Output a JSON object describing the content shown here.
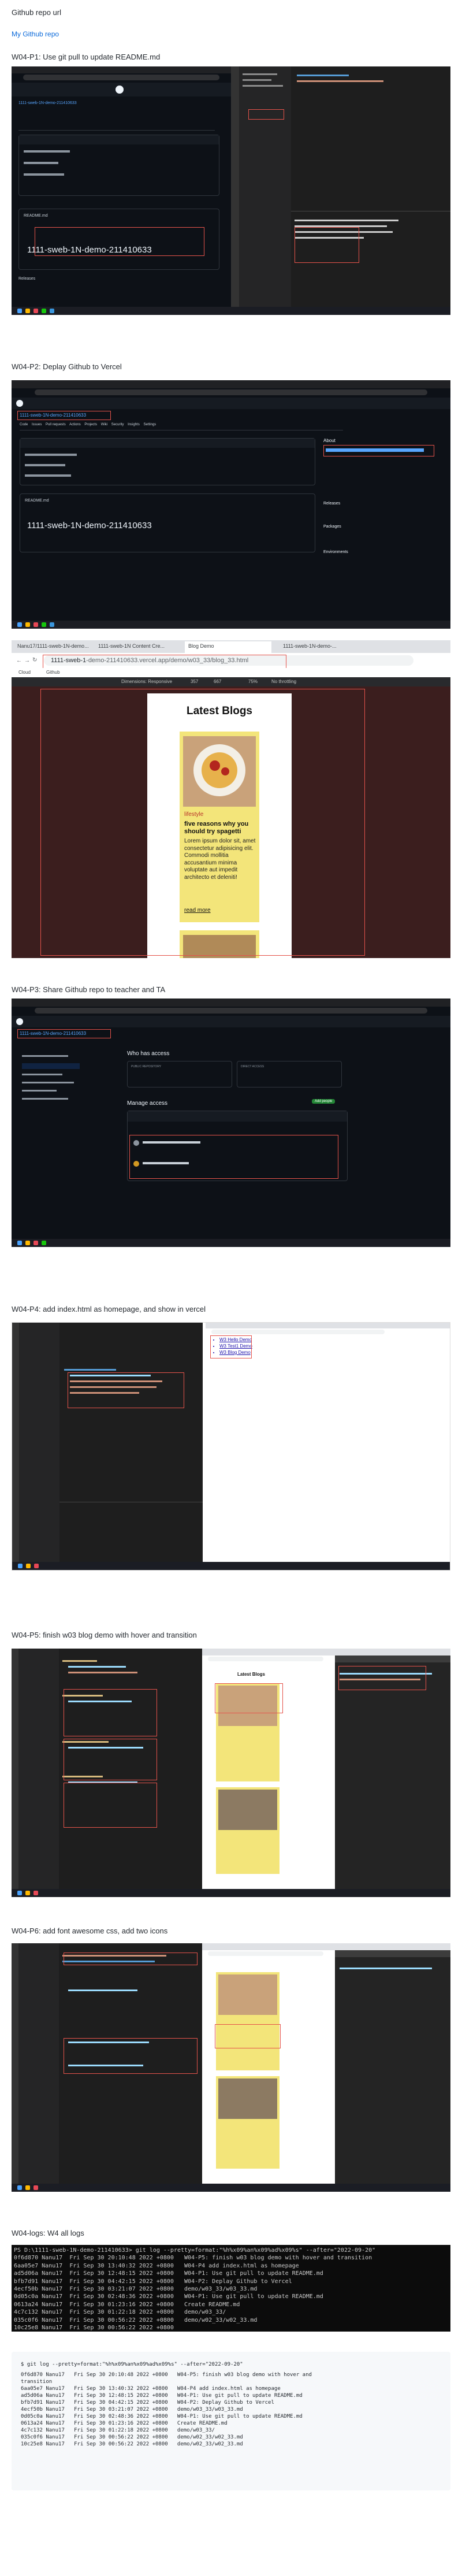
{
  "page": {
    "repo_heading": "Github repo url",
    "repo_link": "My Github repo"
  },
  "sections": {
    "p1": {
      "title": "W04-P1: Use git pull to update README.md"
    },
    "p2": {
      "title": "W04-P2: Deplay Github to Vercel"
    },
    "p3": {
      "title": "W04-P3: Share Github repo to teacher and TA"
    },
    "p4": {
      "title": "W04-P4: add index.html as homepage, and show in vercel"
    },
    "p5": {
      "title": "W04-P5: finish w03 blog demo with hover and transition"
    },
    "p6": {
      "title": "W04-P6: add font awesome css, add two icons"
    },
    "logs": {
      "title": "W04-logs: W4 all logs"
    }
  },
  "github": {
    "repo_name": "1111-sweb-1N-demo-211410633",
    "readme_label": "README.md",
    "commit_author": "Nanu17",
    "branch": "main",
    "pages_tabs": [
      "Code",
      "Issues",
      "Pull requests",
      "Actions",
      "Projects",
      "Wiki",
      "Security",
      "Insights",
      "Settings"
    ],
    "about_label": "About",
    "releases_label": "Releases",
    "packages_label": "Packages",
    "environments_label": "Environments"
  },
  "vercel": {
    "url": "1111-sweb-1N-demo-211410633.vercel.app/demo/w03_33/blog_33.html",
    "url_short": "1111-sweb-1",
    "url_tail": "-demo-211410633.vercel.app/demo/w03_33/blog_33.html",
    "tabs": [
      "Nanu17/1111-sweb-1N-demo...",
      "1111-sweb-1N Content Cre...",
      "Blog Demo",
      "1111-sweb-1N-demo-..."
    ],
    "device_toolbar": "Dimensions: Responsive",
    "width": "357",
    "height": "667",
    "zoom": "75%",
    "throttle": "No throttling",
    "bookmarks": [
      "Cloud",
      "Github"
    ]
  },
  "blog": {
    "heading": "Latest Blogs",
    "category": "lifestyle",
    "post_title": "five reasons why you should try spagetti",
    "post_body": "Lorem ipsum dolor sit, amet consectetur adipisicing elit. Commodi mollitia accusantium minima voluptate aut impedit architecto et deleniti!",
    "read_more": "read more"
  },
  "access": {
    "who_has_access": "Who has access",
    "manage_access": "Manage access",
    "public_repo": "PUBLIC REPOSITORY",
    "direct_access": "DIRECT ACCESS",
    "add_people": "Add people"
  },
  "index_links": [
    "W3 Hello Demo",
    "W3 Test1 Demo",
    "W3 Blog Demo"
  ],
  "logs": {
    "console_command": "PS D:\\1111-sweb-1N-demo-211410633> git log --pretty=format:\"%h%x09%an%x09%ad%x09%s\" --after=\"2022-09-20\"",
    "console_lines": [
      "0f6d870 Nanu17  Fri Sep 30 20:10:48 2022 +0800   W04-P5: finish w03 blog demo with hover and transition",
      "6aa05e7 Nanu17  Fri Sep 30 13:40:32 2022 +0800   W04-P4 add index.html as homepage",
      "ad5d06a Nanu17  Fri Sep 30 12:48:15 2022 +0800   W04-P1: Use git pull to update README.md",
      "bfb7d91 Nanu17  Fri Sep 30 04:42:15 2022 +0800   W04-P2: Deplay Github to Vercel",
      "4ecf50b Nanu17  Fri Sep 30 03:21:07 2022 +0800   demo/w03_33/w03_33.md",
      "0d05c0a Nanu17  Fri Sep 30 02:48:36 2022 +0800   W04-P1: Use git pull to update README.md",
      "0613a24 Nanu17  Fri Sep 30 01:23:16 2022 +0800   Create README.md",
      "4c7c132 Nanu17  Fri Sep 30 01:22:18 2022 +0800   demo/w03_33/",
      "035c0f6 Nanu17  Fri Sep 30 00:56:22 2022 +0800   demo/w02_33/w02_33.md",
      "10c25e8 Nanu17  Fri Sep 30 00:56:22 2022 +0800"
    ],
    "code_command": "$ git log --pretty=format:\"%h%x09%an%x09%ad%x09%s\" --after=\"2022-09-20\"",
    "code_lines": [
      "0f6d870 Nanu17   Fri Sep 30 20:10:48 2022 +0800   W04-P5: finish w03 blog demo with hover and",
      "transition",
      "6aa05e7 Nanu17   Fri Sep 30 13:40:32 2022 +0800   W04-P4 add index.html as homepage",
      "ad5d06a Nanu17   Fri Sep 30 12:48:15 2022 +0800   W04-P1: Use git pull to update README.md",
      "bfb7d91 Nanu17   Fri Sep 30 04:42:15 2022 +0800   W04-P2: Deplay Github to Vercel",
      "4ecf50b Nanu17   Fri Sep 30 03:21:07 2022 +0800   demo/w03_33/w03_33.md",
      "0d05c0a Nanu17   Fri Sep 30 02:48:36 2022 +0800   W04-P1: Use git pull to update README.md",
      "0613a24 Nanu17   Fri Sep 30 01:23:16 2022 +0800   Create README.md",
      "4c7c132 Nanu17   Fri Sep 30 01:22:18 2022 +0800   demo/w03_33/",
      "035c0f6 Nanu17   Fri Sep 30 00:56:22 2022 +0800   demo/w02_33/w02_33.md",
      "10c25e8 Nanu17   Fri Sep 30 00:56:22 2022 +0800   demo/w02_33/w02_33.md"
    ]
  },
  "colors": {
    "link": "#0969da",
    "github_dark": "#0d1117",
    "vscode_dark": "#1e1e1e",
    "highlight_red": "#e5534b",
    "blog_card": "#f3e57a",
    "blog_page_bg": "#3b1e1e"
  }
}
